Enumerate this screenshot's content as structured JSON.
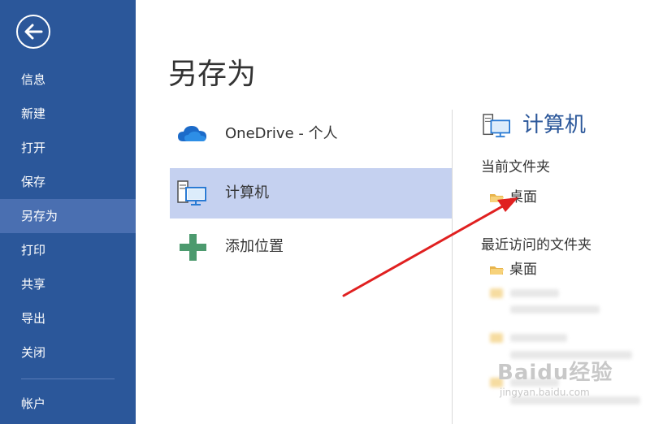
{
  "sidebar": {
    "back_icon": "back-arrow-icon",
    "items": [
      {
        "label": "信息"
      },
      {
        "label": "新建"
      },
      {
        "label": "打开"
      },
      {
        "label": "保存"
      },
      {
        "label": "另存为",
        "active": true
      },
      {
        "label": "打印"
      },
      {
        "label": "共享"
      },
      {
        "label": "导出"
      },
      {
        "label": "关闭"
      },
      {
        "label": "帐户"
      }
    ]
  },
  "page": {
    "title": "另存为"
  },
  "locations": [
    {
      "label": "OneDrive - 个人",
      "icon": "cloud-icon"
    },
    {
      "label": "计算机",
      "icon": "computer-icon",
      "selected": true
    },
    {
      "label": "添加位置",
      "icon": "plus-icon"
    }
  ],
  "panel": {
    "title": "计算机",
    "current_folder_heading": "当前文件夹",
    "current_folder": "桌面",
    "recent_heading": "最近访问的文件夹",
    "recent_folders": [
      "桌面"
    ]
  },
  "watermark": {
    "main": "Baidu经验",
    "sub": "jingyan.baidu.com"
  },
  "colors": {
    "sidebar": "#2b579a",
    "selected": "#c5d1f0",
    "accent": "#2b579a",
    "arrow": "#e02020"
  }
}
